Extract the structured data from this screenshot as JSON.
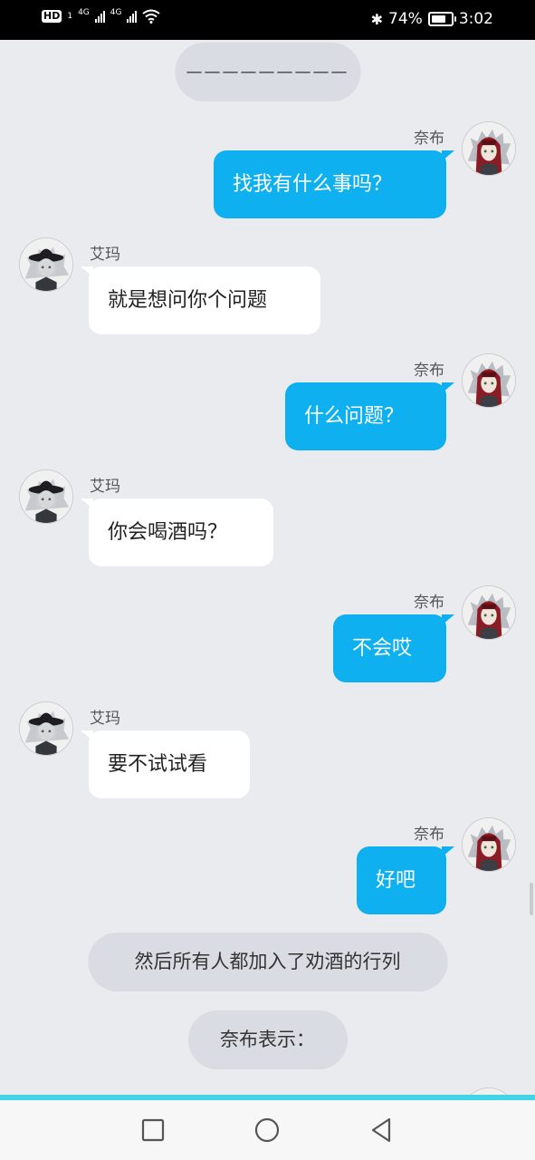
{
  "status_bar": {
    "hd": "HD",
    "sim": "1",
    "net1": "4G",
    "net2": "4G",
    "battery_text": "74%",
    "battery_level": 0.74,
    "time": "3:02",
    "icons": [
      "bluetooth-icon",
      "wifi-icon",
      "battery-icon",
      "signal-icon"
    ]
  },
  "colors": {
    "accent": "#0fb0ef",
    "background": "#e9ebef",
    "system_pill": "#d9dce3",
    "divider": "#41d3e6"
  },
  "messages": [
    {
      "type": "system",
      "text": "—————————"
    },
    {
      "type": "right",
      "name": "奈布",
      "text": "找我有什么事吗？"
    },
    {
      "type": "left",
      "name": "艾玛",
      "text": "就是想问你个问题"
    },
    {
      "type": "right",
      "name": "奈布",
      "text": "什么问题？"
    },
    {
      "type": "left",
      "name": "艾玛",
      "text": "你会喝酒吗？"
    },
    {
      "type": "right",
      "name": "奈布",
      "text": "不会哎"
    },
    {
      "type": "left",
      "name": "艾玛",
      "text": "要不试试看"
    },
    {
      "type": "right",
      "name": "奈布",
      "text": "好吧"
    },
    {
      "type": "system",
      "text": "然后所有人都加入了劝酒的行列"
    },
    {
      "type": "system",
      "text": "奈布表示："
    }
  ],
  "nav": {
    "icons": [
      "recent-apps-icon",
      "home-icon",
      "back-icon"
    ]
  }
}
